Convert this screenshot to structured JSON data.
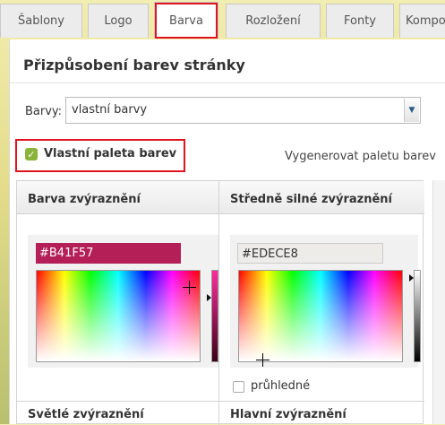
{
  "tabs": [
    {
      "label": "Šablony",
      "active": false
    },
    {
      "label": "Logo",
      "active": false
    },
    {
      "label": "Barva",
      "active": true
    },
    {
      "label": "Rozložení",
      "active": false
    },
    {
      "label": "Fonty",
      "active": false
    },
    {
      "label": "Kompo",
      "active": false
    }
  ],
  "panel": {
    "title": "Přizpůsobení barev stránky",
    "colors_label": "Barvy:",
    "colors_select_value": "vlastní barvy",
    "custom_palette_label": "Vlastní paleta barev",
    "custom_palette_checked": true,
    "generate_palette_link": "Vygenerovat paletu barev"
  },
  "columns": [
    {
      "header": "Barva zvýraznění",
      "hex": "#B41F57",
      "hex_bg": "#B41F57",
      "hex_text_color": "#ffffff"
    },
    {
      "header": "Středně silné zvýraznění",
      "hex": "#EDECE8",
      "hex_bg": "#EDECE8",
      "hex_text_color": "#333333",
      "transparent_label": "průhledné",
      "transparent_checked": false
    }
  ],
  "bottom_row": {
    "left_label": "Světlé zvýraznění",
    "right_label": "Hlavní zvýraznění"
  },
  "colors": {
    "accent_green": "#8ab33a",
    "highlight_red": "#e0141e"
  },
  "icons": {
    "select_arrow": "chevron-down-icon",
    "checkbox": "checkmark-icon",
    "picker_cursor": "crosshair-icon"
  }
}
